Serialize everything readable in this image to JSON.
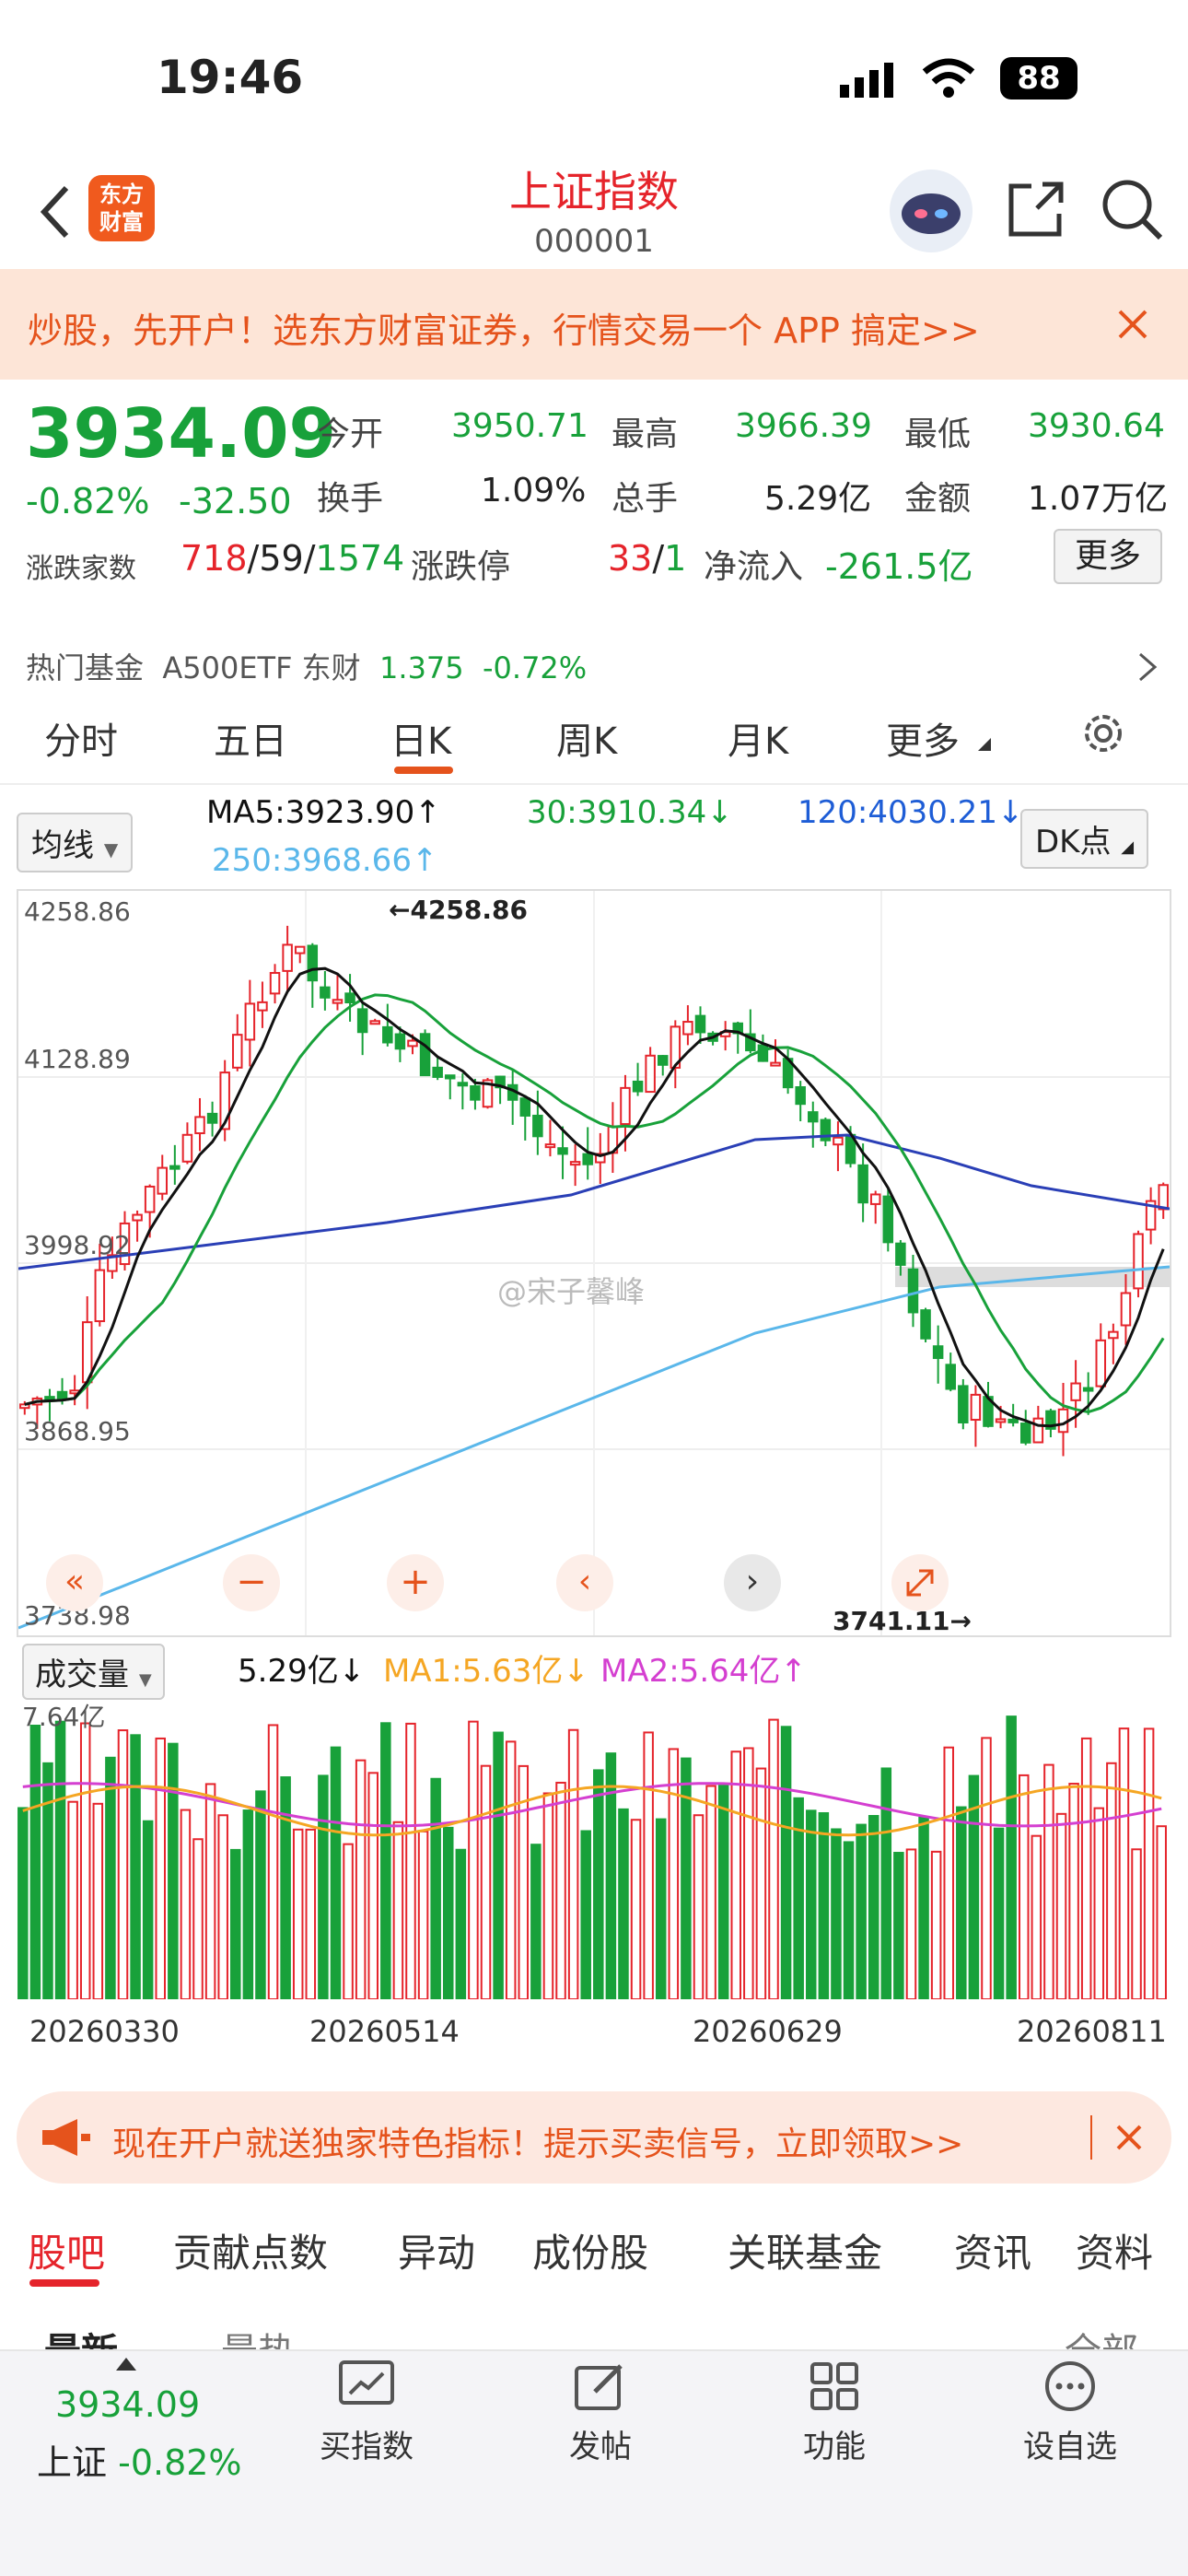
{
  "status": {
    "time": "19:46",
    "battery": "88"
  },
  "nav": {
    "brand_line1": "东方",
    "brand_line2": "财富",
    "title": "上证指数",
    "code": "000001"
  },
  "banner1": {
    "text": "炒股，先开户！选东方财富证券，行情交易一个 APP 搞定>>"
  },
  "quote": {
    "price": "3934.09",
    "change_pct": "-0.82%",
    "change": "-32.50",
    "open_label": "今开",
    "open": "3950.71",
    "high_label": "最高",
    "high": "3966.39",
    "low_label": "最低",
    "low": "3930.64",
    "turnover_label": "换手",
    "turnover": "1.09%",
    "volume_label": "总手",
    "volume": "5.29亿",
    "amount_label": "金额",
    "amount": "1.07万亿",
    "breadth_label": "涨跌家数",
    "up": "718",
    "flat": "59",
    "down": "1574",
    "sep": "/",
    "limit_label": "涨跌停",
    "limit_up": "33",
    "limit_down": "1",
    "inflow_label": "净流入",
    "inflow": "-261.5亿",
    "more": "更多"
  },
  "fund": {
    "label": "热门基金",
    "name": "A500ETF 东财",
    "price": "1.375",
    "pct": "-0.72%"
  },
  "tabs": [
    "分时",
    "五日",
    "日K",
    "周K",
    "月K",
    "更多"
  ],
  "ma": {
    "selector": "均线",
    "ma5": "MA5:3923.90↑",
    "ma30": "30:3910.34↓",
    "ma120": "120:4030.21↓",
    "ma250": "250:3968.66↑",
    "dk": "DK点"
  },
  "chart_data": {
    "type": "candlestick",
    "y_labels": [
      "4258.86",
      "4128.89",
      "3998.92",
      "3868.95",
      "3738.98"
    ],
    "ylim": [
      3738.98,
      4258.86
    ],
    "high_marker": "4258.86",
    "low_marker": "3741.11",
    "watermark": "@宋子馨峰",
    "volume": {
      "selector": "成交量",
      "value": "5.29亿↓",
      "ma1": "MA1:5.63亿↓",
      "ma2": "MA2:5.64亿↑",
      "max_label": "7.64亿"
    },
    "x_labels": [
      "20260330",
      "20260514",
      "20260629",
      "20260811"
    ]
  },
  "colors": {
    "up": "#e5242b",
    "down": "#18a13a",
    "ma5": "#111111",
    "ma30": "#18a13a",
    "ma120": "#2a3fb6",
    "ma250": "#5ab7ea"
  },
  "banner2": {
    "text": "现在开户就送独家特色指标！提示买卖信号，立即领取>>"
  },
  "subtabs": [
    "股吧",
    "贡献点数",
    "异动",
    "成份股",
    "关联基金",
    "资讯",
    "资料"
  ],
  "peek": {
    "left1": "最新",
    "left2": "最热",
    "right": "全部"
  },
  "bottom": {
    "price": "3934.09",
    "name": "上证",
    "pct": "-0.82%",
    "items": [
      "买指数",
      "发帖",
      "功能",
      "设自选"
    ]
  }
}
